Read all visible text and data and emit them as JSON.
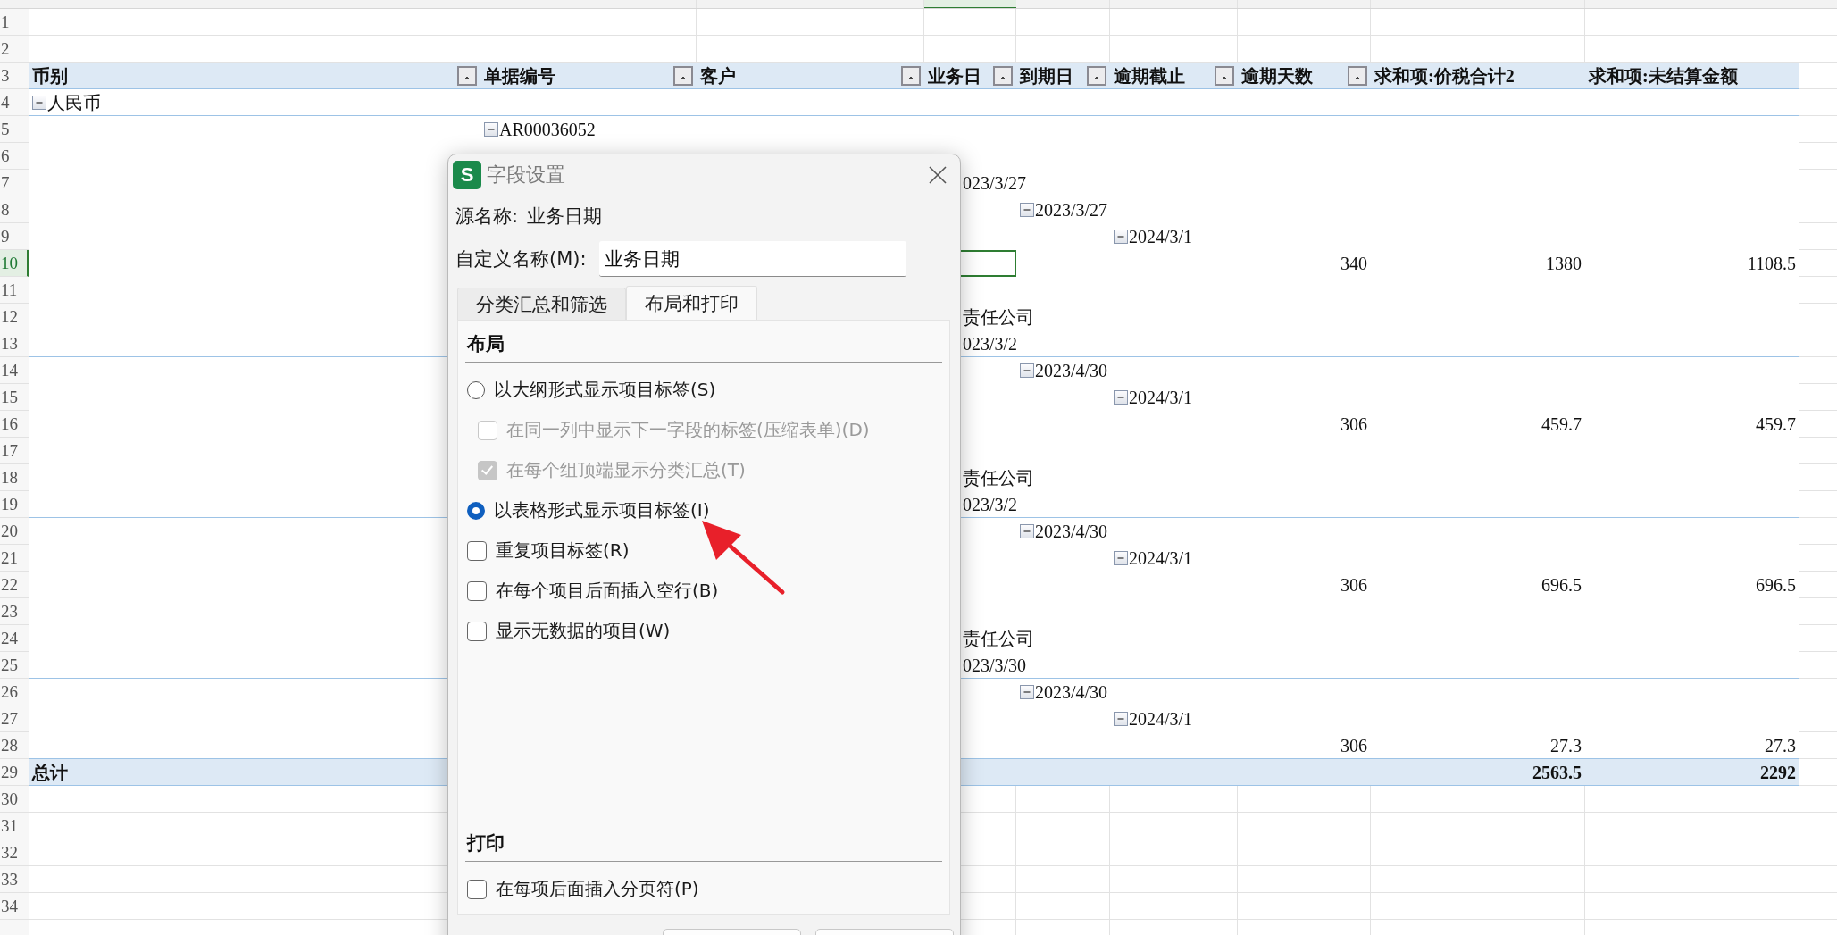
{
  "sheet": {
    "rows": [
      {
        "number": "1",
        "kind": "blank",
        "selected": false,
        "divider": false
      },
      {
        "number": "2",
        "kind": "blank",
        "selected": false,
        "divider": false
      },
      {
        "number": "3",
        "kind": "header",
        "selected": false,
        "divider": true,
        "cells": {
          "currency": {
            "text": "币别",
            "filter_button": true
          },
          "doc_number": {
            "text": "单据编号",
            "filter_button": true
          },
          "customer": {
            "text": "客户",
            "filter_button": true
          },
          "business_date": {
            "text": "业务日",
            "filter_button": true
          },
          "due_date": {
            "text": "到期日",
            "filter_button": true
          },
          "overdue_cutoff": {
            "text": "逾期截止",
            "filter_button": true
          },
          "overdue_days": {
            "text": "逾期天数",
            "filter_button": true
          },
          "sum_tax_total": {
            "text": "求和项:价税合计2"
          },
          "sum_unsettled": {
            "text": "求和项:未结算金额"
          }
        }
      },
      {
        "number": "4",
        "kind": "item",
        "selected": false,
        "divider": true,
        "cells": {
          "currency": {
            "text": "人民币",
            "expanded": true
          }
        }
      },
      {
        "number": "5",
        "kind": "item",
        "selected": false,
        "divider": false,
        "cells": {
          "doc_number": {
            "text": "AR00036052",
            "expanded": true
          }
        }
      },
      {
        "number": "6",
        "kind": "item",
        "selected": false,
        "divider": false
      },
      {
        "number": "7",
        "kind": "item",
        "selected": false,
        "divider": true,
        "cells": {
          "business_date": {
            "text": "023/3/27"
          }
        }
      },
      {
        "number": "8",
        "kind": "item",
        "selected": false,
        "divider": false,
        "cells": {
          "due_date": {
            "text": "2023/3/27",
            "expanded": true
          }
        }
      },
      {
        "number": "9",
        "kind": "item",
        "selected": false,
        "divider": false,
        "cells": {
          "overdue_cutoff": {
            "text": "2024/3/1",
            "expanded": true
          }
        }
      },
      {
        "number": "10",
        "kind": "item",
        "selected": true,
        "divider": false,
        "cells": {
          "overdue_days": {
            "text": "340"
          },
          "sum_tax_total": {
            "text": "1380"
          },
          "sum_unsettled": {
            "text": "1108.5"
          }
        }
      },
      {
        "number": "11",
        "kind": "item",
        "selected": false,
        "divider": false
      },
      {
        "number": "12",
        "kind": "item",
        "selected": false,
        "divider": false,
        "cells": {
          "customer": {
            "text": "责任公司"
          }
        }
      },
      {
        "number": "13",
        "kind": "item",
        "selected": false,
        "divider": true,
        "cells": {
          "business_date": {
            "text": "023/3/2"
          }
        }
      },
      {
        "number": "14",
        "kind": "item",
        "selected": false,
        "divider": false,
        "cells": {
          "due_date": {
            "text": "2023/4/30",
            "expanded": true
          }
        }
      },
      {
        "number": "15",
        "kind": "item",
        "selected": false,
        "divider": false,
        "cells": {
          "overdue_cutoff": {
            "text": "2024/3/1",
            "expanded": true
          }
        }
      },
      {
        "number": "16",
        "kind": "item",
        "selected": false,
        "divider": false,
        "cells": {
          "overdue_days": {
            "text": "306"
          },
          "sum_tax_total": {
            "text": "459.7"
          },
          "sum_unsettled": {
            "text": "459.7"
          }
        }
      },
      {
        "number": "17",
        "kind": "item",
        "selected": false,
        "divider": false
      },
      {
        "number": "18",
        "kind": "item",
        "selected": false,
        "divider": false,
        "cells": {
          "customer": {
            "text": "责任公司"
          }
        }
      },
      {
        "number": "19",
        "kind": "item",
        "selected": false,
        "divider": true,
        "cells": {
          "business_date": {
            "text": "023/3/2"
          }
        }
      },
      {
        "number": "20",
        "kind": "item",
        "selected": false,
        "divider": false,
        "cells": {
          "due_date": {
            "text": "2023/4/30",
            "expanded": true
          }
        }
      },
      {
        "number": "21",
        "kind": "item",
        "selected": false,
        "divider": false,
        "cells": {
          "overdue_cutoff": {
            "text": "2024/3/1",
            "expanded": true
          }
        }
      },
      {
        "number": "22",
        "kind": "item",
        "selected": false,
        "divider": false,
        "cells": {
          "overdue_days": {
            "text": "306"
          },
          "sum_tax_total": {
            "text": "696.5"
          },
          "sum_unsettled": {
            "text": "696.5"
          }
        }
      },
      {
        "number": "23",
        "kind": "item",
        "selected": false,
        "divider": false
      },
      {
        "number": "24",
        "kind": "item",
        "selected": false,
        "divider": false,
        "cells": {
          "customer": {
            "text": "责任公司"
          }
        }
      },
      {
        "number": "25",
        "kind": "item",
        "selected": false,
        "divider": true,
        "cells": {
          "business_date": {
            "text": "023/3/30"
          }
        }
      },
      {
        "number": "26",
        "kind": "item",
        "selected": false,
        "divider": false,
        "cells": {
          "due_date": {
            "text": "2023/4/30",
            "expanded": true
          }
        }
      },
      {
        "number": "27",
        "kind": "item",
        "selected": false,
        "divider": false,
        "cells": {
          "overdue_cutoff": {
            "text": "2024/3/1",
            "expanded": true
          }
        }
      },
      {
        "number": "28",
        "kind": "item",
        "selected": false,
        "divider": true,
        "cells": {
          "overdue_days": {
            "text": "306"
          },
          "sum_tax_total": {
            "text": "27.3"
          },
          "sum_unsettled": {
            "text": "27.3"
          }
        }
      },
      {
        "number": "29",
        "kind": "total",
        "selected": false,
        "divider": true,
        "cells": {
          "currency": {
            "text": "总计"
          },
          "sum_tax_total": {
            "text": "2563.5"
          },
          "sum_unsettled": {
            "text": "2292"
          }
        }
      },
      {
        "number": "30",
        "kind": "blank",
        "selected": false,
        "divider": false
      },
      {
        "number": "31",
        "kind": "blank",
        "selected": false,
        "divider": false
      },
      {
        "number": "32",
        "kind": "blank",
        "selected": false,
        "divider": false
      },
      {
        "number": "33",
        "kind": "blank",
        "selected": false,
        "divider": false
      },
      {
        "number": "34",
        "kind": "blank",
        "selected": false,
        "divider": false
      }
    ]
  },
  "dialog": {
    "icon_text": "S",
    "title": "字段设置",
    "source_label": "源名称:",
    "source_value": "业务日期",
    "custom_name_label": "自定义名称(M):",
    "custom_name_value": "业务日期",
    "tabs": [
      {
        "label": "分类汇总和筛选",
        "selected": false
      },
      {
        "label": "布局和打印",
        "selected": true
      }
    ],
    "sections": [
      {
        "title": "布局",
        "options": [
          {
            "kind": "radio",
            "label": "以大纲形式显示项目标签(S)",
            "selected": false,
            "disabled": false,
            "children": [
              {
                "kind": "checkbox",
                "label": "在同一列中显示下一字段的标签(压缩表单)(D)",
                "checked": false,
                "disabled": true
              },
              {
                "kind": "checkbox",
                "label": "在每个组顶端显示分类汇总(T)",
                "checked": true,
                "disabled": true
              }
            ]
          },
          {
            "kind": "radio",
            "label": "以表格形式显示项目标签(I)",
            "selected": true,
            "disabled": false
          },
          {
            "kind": "checkbox",
            "label": "重复项目标签(R)",
            "checked": false,
            "disabled": false
          },
          {
            "kind": "checkbox",
            "label": "在每个项目后面插入空行(B)",
            "checked": false,
            "disabled": false
          },
          {
            "kind": "checkbox",
            "label": "显示无数据的项目(W)",
            "checked": false,
            "disabled": false
          }
        ]
      },
      {
        "title": "打印",
        "options": [
          {
            "kind": "checkbox",
            "label": "在每项后面插入分页符(P)",
            "checked": false,
            "disabled": false
          }
        ]
      }
    ]
  }
}
